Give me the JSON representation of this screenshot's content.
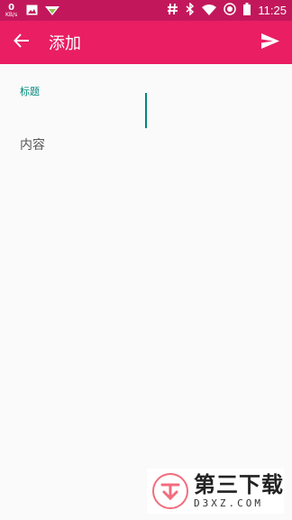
{
  "status_bar": {
    "net_speed": "0",
    "net_unit": "KB/s",
    "time": "11:25",
    "icons": [
      "image-icon",
      "signal-triangle-icon",
      "hash-icon",
      "bluetooth-icon",
      "wifi-icon",
      "data-saver-icon",
      "battery-icon"
    ]
  },
  "app_bar": {
    "title": "添加",
    "back_icon": "arrow-back-icon",
    "send_icon": "send-icon",
    "color": "#e91e63"
  },
  "form": {
    "title_label": "标题",
    "title_value": "",
    "content_placeholder": "内容",
    "accent_color": "#00897b"
  },
  "watermark": {
    "brand": "第三下载",
    "url": "D3XZ.COM"
  }
}
